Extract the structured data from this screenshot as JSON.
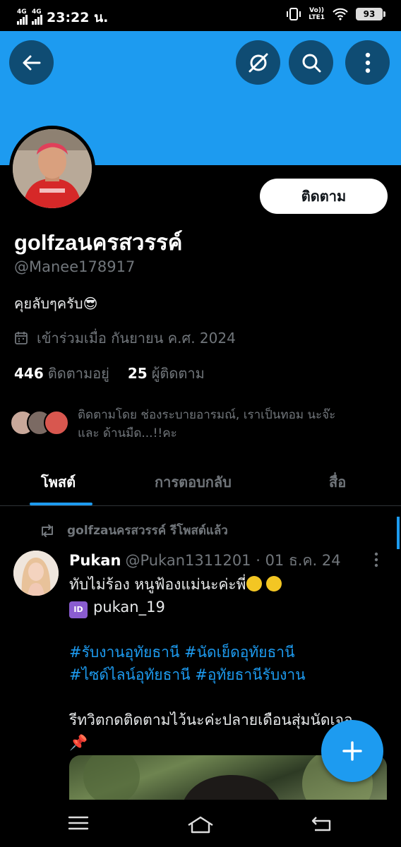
{
  "status_bar": {
    "network_1": "4G",
    "network_2": "4G",
    "time": "23:22 น.",
    "volte_top": "Vo))",
    "volte_bottom": "LTE1",
    "battery": "93"
  },
  "header": {
    "icons": [
      "back-arrow-icon",
      "grok-icon",
      "search-icon",
      "more-vertical-icon"
    ]
  },
  "profile": {
    "follow_label": "ติดตาม",
    "display_name": "golfzaนครสวรรค์",
    "handle": "@Manee178917",
    "bio": "คุยลับๆครับ",
    "bio_emoji": "😎",
    "joined": "เข้าร่วมเมื่อ กันยายน ค.ศ. 2024",
    "following_count": "446",
    "following_label": "ติดตามอยู่",
    "followers_count": "25",
    "followers_label": "ผู้ติดตาม",
    "followed_by_line1": "ติดตามโดย ช่องระบายอารมณ์, เราเป็นทอม นะจ๊ะ",
    "followed_by_line2": "และ ด้านมืด...!!คะ"
  },
  "tabs": [
    {
      "label": "โพสต์",
      "active": true
    },
    {
      "label": "การตอบกลับ",
      "active": false
    },
    {
      "label": "สื่อ",
      "active": false
    }
  ],
  "post": {
    "repost_label": "golfzaนครสวรรค์ รีโพสต์แล้ว",
    "author_name": "Pukan",
    "author_meta": "@Pukan1311201 · 01 ธ.ค. 24",
    "line1": "ทับไม่ร้อง หนูฟ้องแม่นะค่ะพี่",
    "id_badge": "ID",
    "line2": "pukan_19",
    "hashtags_line1": "#รับงานอุทัยธานี #นัดเย็ดอุทัยธานี",
    "hashtags_line2": "#ไซด์ไลน์อุทัยธานี #อุทัยธานีรับงาน",
    "line3": "รีทวิตกดติดตามไว้นะค่ะปลายเดือนสุ่มนัดเจอ",
    "pin_emoji": "📌"
  },
  "colors": {
    "accent": "#1d9bf0",
    "banner": "#1d9bf0",
    "background": "#000000",
    "muted_text": "#71767b"
  }
}
